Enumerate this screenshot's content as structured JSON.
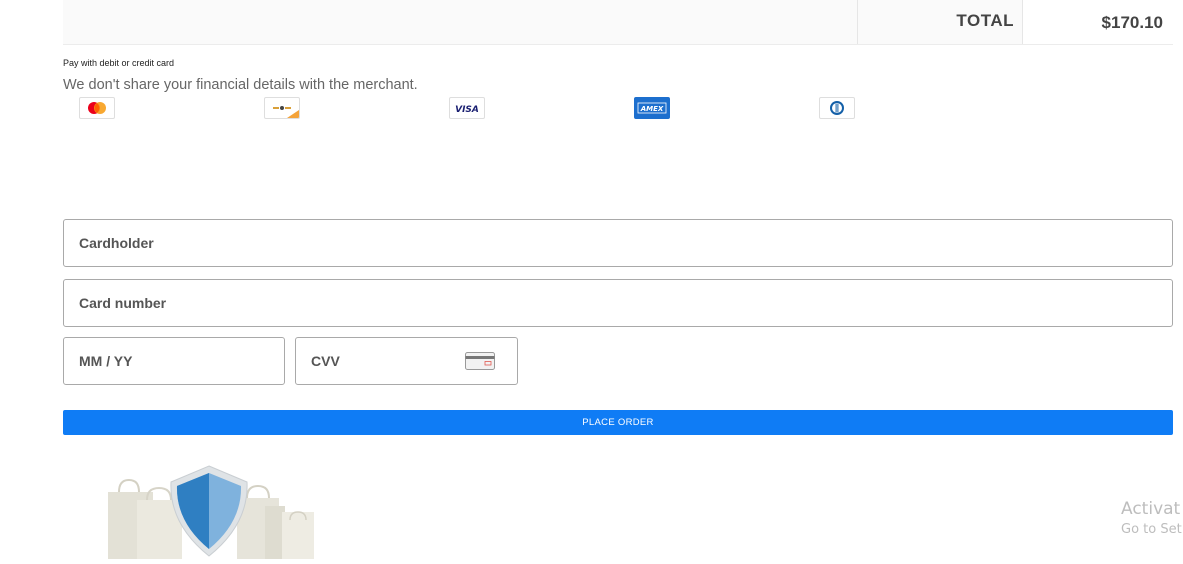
{
  "order_summary": {
    "total_label": "TOTAL",
    "total_value": "$170.10"
  },
  "payment": {
    "title": "Pay with debit or credit card",
    "subtitle": "We don't share your financial details with the merchant.",
    "card_logos": [
      {
        "icon": "mastercard-icon"
      },
      {
        "icon": "maestro-icon"
      },
      {
        "icon": "visa-icon",
        "text": "VISA"
      },
      {
        "icon": "amex-icon",
        "text": "AMEX"
      },
      {
        "icon": "diners-club-icon"
      }
    ]
  },
  "form": {
    "cardholder_placeholder": "Cardholder",
    "card_number_placeholder": "Card number",
    "expiry_placeholder": "MM / YY",
    "cvv_placeholder": "CVV"
  },
  "actions": {
    "place_order_label": "PLACE ORDER"
  },
  "watermark": {
    "title": "Activat",
    "subtitle": "Go to Set"
  },
  "colors": {
    "accent": "#0f7cf5",
    "amex_blue": "#1d6fce",
    "visa_navy": "#1a1f71",
    "mastercard_red": "#eb001b",
    "mastercard_orange": "#f79e1b",
    "shield_blue": "#2f7fc2"
  }
}
